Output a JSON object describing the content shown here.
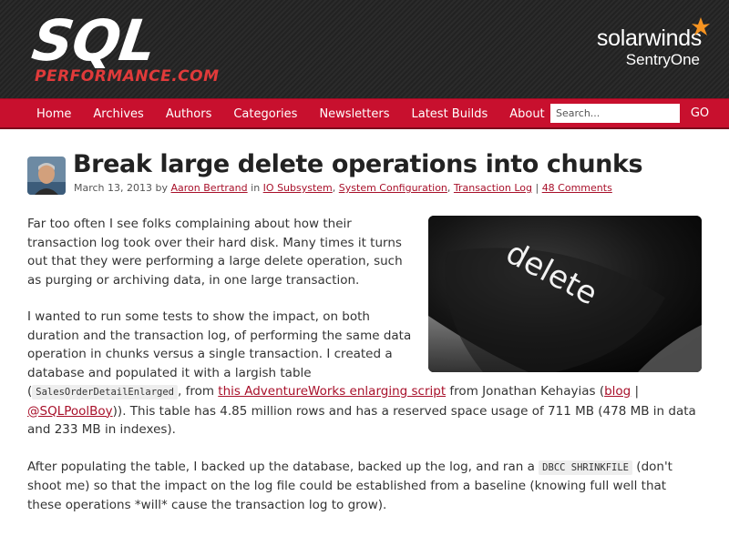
{
  "header": {
    "logo_main": "SQL",
    "logo_sub": "PERFORMANCE.COM",
    "sponsor_main": "solarwinds",
    "sponsor_sub": "SentryOne"
  },
  "nav": {
    "items": [
      "Home",
      "Archives",
      "Authors",
      "Categories",
      "Newsletters",
      "Latest Builds",
      "About"
    ],
    "search_placeholder": "Search...",
    "go_label": "GO"
  },
  "article": {
    "title": "Break large delete operations into chunks",
    "date": "March 13, 2013",
    "by": "by",
    "author": "Aaron Bertrand",
    "in": "in",
    "categories": [
      "IO Subsystem",
      "System Configuration",
      "Transaction Log"
    ],
    "comments": "48 Comments",
    "image_text": "delete",
    "p1": "Far too often I see folks complaining about how their transaction log took over their hard disk. Many times it turns out that they were performing a large delete operation, such as purging or archiving data, in one large transaction.",
    "p2_a": "I wanted to run some tests to show the impact, on both duration and the transaction log, of performing the same data operation in chunks versus a single transaction. I created a database and populated it with a largish table",
    "p2_code": "SalesOrderDetailEnlarged",
    "p2_b": ", from",
    "p2_link": "this AdventureWorks enlarging script",
    "p2_c": "from Jonathan Kehayias (",
    "p2_blog": "blog",
    "p2_sep": "|",
    "p2_twitter": "@SQLPoolBoy",
    "p2_d": ")). This table has 4.85 million rows and has a reserved space usage of 711 MB (478 MB in data and 233 MB in indexes).",
    "p3_a": "After populating the table, I backed up the database, backed up the log, and ran a",
    "p3_code": "DBCC SHRINKFILE",
    "p3_b": "(don't shoot me) so that the impact on the log file could be established from a baseline (knowing full well that these operations *will* cause the transaction log to grow)."
  },
  "colors": {
    "nav_red": "#c8102e",
    "link_red": "#a8102a",
    "header_dark": "#262626",
    "sponsor_orange": "#f79421"
  }
}
